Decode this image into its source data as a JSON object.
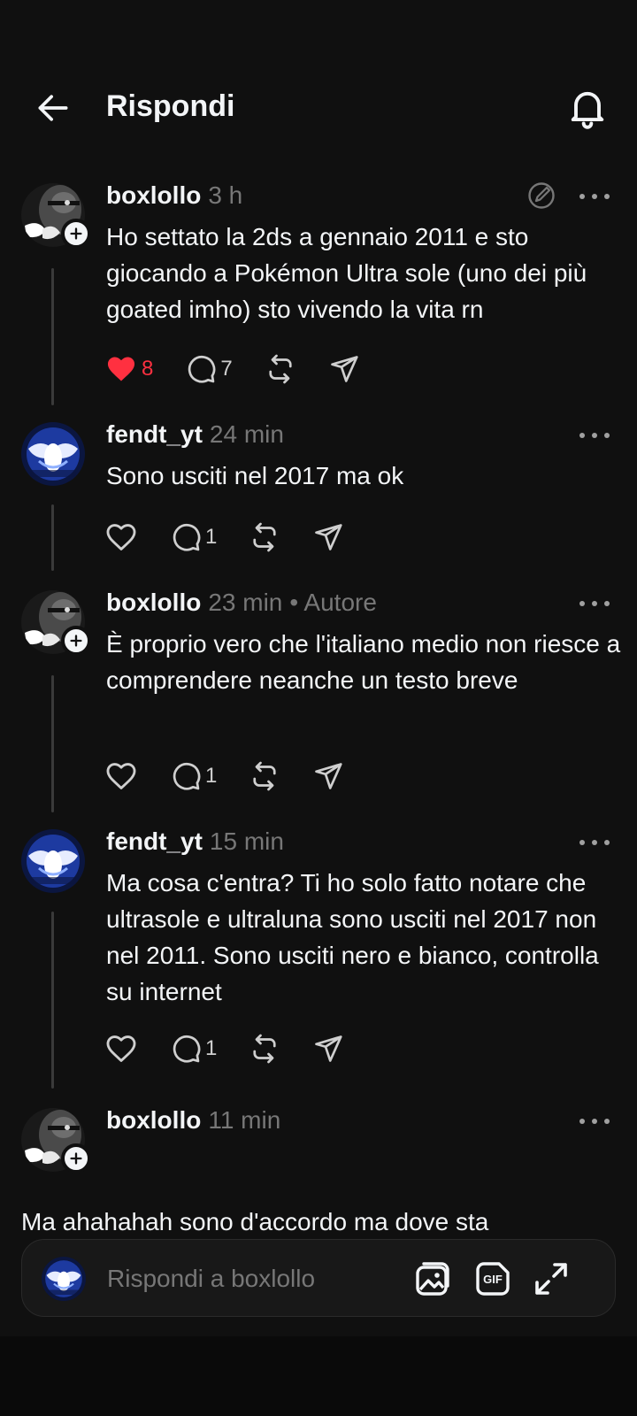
{
  "header": {
    "title": "Rispondi"
  },
  "posts": [
    {
      "username": "boxlollo",
      "time": "3 h",
      "author": "",
      "text": "Ho settato la 2ds a gennaio 2011 e sto giocando a Pokémon Ultra sole (uno dei più goated imho) sto vivendo la vita rn",
      "likes": "8",
      "replies": "7",
      "liked": true,
      "avatar": "dark-face"
    },
    {
      "username": "fendt_yt",
      "time": "24 min",
      "author": "",
      "text": "Sono usciti nel 2017 ma ok",
      "likes": "",
      "replies": "1",
      "liked": false,
      "avatar": "lugia-blue"
    },
    {
      "username": "boxlollo",
      "time": "23 min",
      "author": "• Autore",
      "text": "È proprio vero che l'italiano medio non riesce a comprendere neanche un testo breve",
      "likes": "",
      "replies": "1",
      "liked": false,
      "avatar": "dark-face"
    },
    {
      "username": "fendt_yt",
      "time": "15 min",
      "author": "",
      "text": "Ma cosa c'entra? Ti ho solo fatto notare che ultrasole e ultraluna sono usciti nel 2017 non nel 2011. Sono usciti nero e bianco, controlla su internet",
      "likes": "",
      "replies": "1",
      "liked": false,
      "avatar": "lugia-blue"
    },
    {
      "username": "boxlollo",
      "time": "11 min",
      "author": "",
      "text": "",
      "likes": "",
      "replies": "",
      "liked": false,
      "avatar": "dark-face"
    }
  ],
  "overflow_text": "Ma ahahahah sono d'accordo ma dove sta",
  "reply_bar": {
    "placeholder": "Rispondi a boxlollo"
  },
  "colors": {
    "like": "#ff3040",
    "background": "#101010",
    "muted": "#777777"
  },
  "icons": [
    "back-arrow-icon",
    "bell-icon",
    "heart-icon",
    "comment-icon",
    "repost-icon",
    "share-icon",
    "more-icon",
    "edit-icon",
    "gallery-icon",
    "gif-icon",
    "expand-icon"
  ]
}
